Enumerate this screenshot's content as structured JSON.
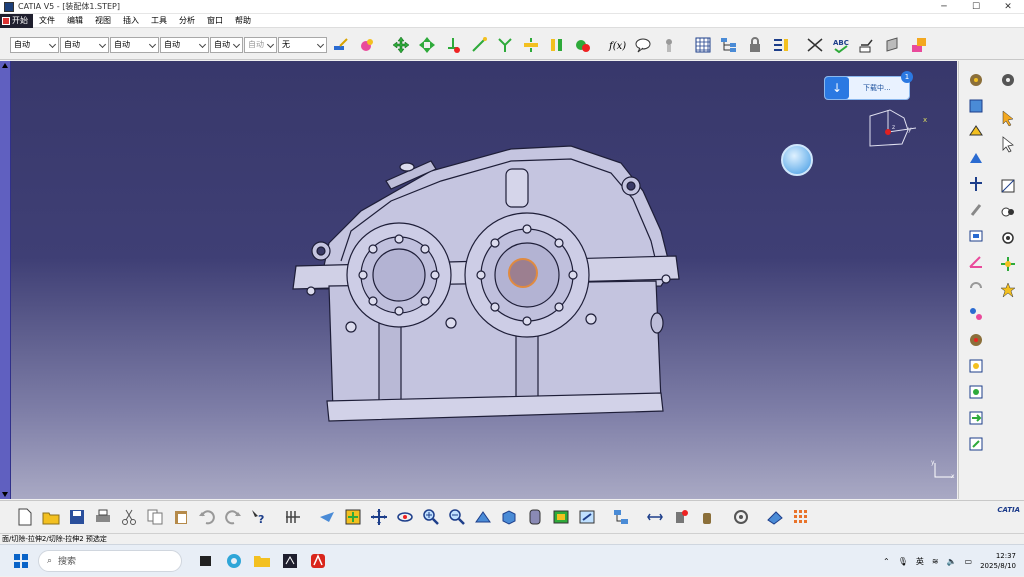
{
  "window": {
    "title": "CATIA V5 - [装配体1.STEP]",
    "controls": {
      "minimize": "─",
      "maximize": "☐",
      "close": "✕"
    }
  },
  "menu": {
    "start": "开始",
    "items": [
      "文件",
      "编辑",
      "视图",
      "插入",
      "工具",
      "分析",
      "窗口",
      "帮助"
    ]
  },
  "properties_toolbar": {
    "selects": [
      "自动",
      "自动",
      "自动",
      "自动",
      "自动",
      "自动",
      "无"
    ]
  },
  "download": {
    "text": "下载中...",
    "badge": "1"
  },
  "compass": {
    "axis_x": "x",
    "axis_y": "y",
    "axis_z": "z"
  },
  "corner_axes": {
    "y": "y",
    "x": "x"
  },
  "brand": {
    "logo_text": "CATIA"
  },
  "status": {
    "text": "面/切除-拉伸2/切除-拉伸2 预选定"
  },
  "taskbar": {
    "search_placeholder": "搜索",
    "ime": "英",
    "time": "12:37",
    "date": "2025/8/10"
  },
  "colors": {
    "viewport_top": "#38386b",
    "viewport_bottom": "#a9a9c4",
    "model_fill": "#c9c9e3",
    "accent_blue": "#2b79e2"
  }
}
